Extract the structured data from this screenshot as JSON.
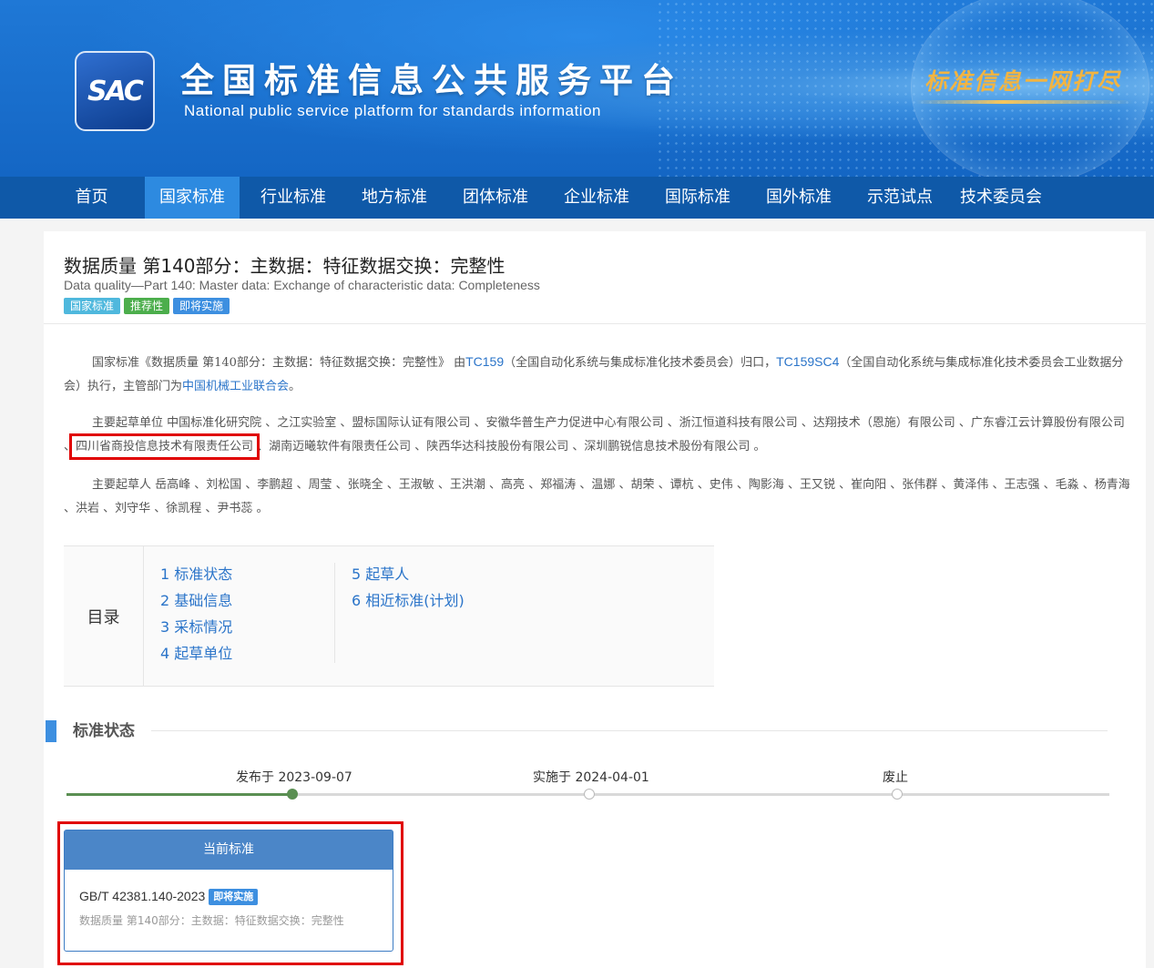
{
  "header": {
    "logo_text": "SAC",
    "site_title": "全国标准信息公共服务平台",
    "site_subtitle": "National public service platform  for standards information",
    "slogan": "标准信息一网打尽"
  },
  "nav": {
    "items": [
      "首页",
      "国家标准",
      "行业标准",
      "地方标准",
      "团体标准",
      "企业标准",
      "国际标准",
      "国外标准",
      "示范试点",
      "技术委员会"
    ],
    "active": "国家标准"
  },
  "standard": {
    "title": "数据质量 第140部分：主数据：特征数据交换：完整性",
    "title_en": "Data quality—Part 140: Master data: Exchange of characteristic data: Completeness",
    "tags": [
      {
        "label": "国家标准",
        "color": "#4fb8dd"
      },
      {
        "label": "推荐性",
        "color": "#4cae4c"
      },
      {
        "label": "即将实施",
        "color": "#3d8fe0"
      }
    ]
  },
  "description": {
    "p1_a": "国家标准《数据质量 第140部分：主数据：特征数据交换：完整性》 由",
    "tc_link": "TC159",
    "p1_b": "（全国自动化系统与集成标准化技术委员会）归口，",
    "sc_link": "TC159SC4",
    "p1_c": "（全国自动化系统与集成标准化技术委员会工业数据分会）执行，主管部门为",
    "dept_link": "中国机械工业联合会",
    "p1_d": "。",
    "units_a": "主要起草单位 中国标准化研究院 、之江实验室 、盟标国际认证有限公司 、安徽华普生产力促进中心有限公司 、浙江恒道科技有限公司 、达翔技术（恩施）有限公司 、广东睿江云计算股份有限公司 、",
    "units_highlight": "四川省商投信息技术有限责任公司",
    "units_b": " 、湖南迈曦软件有限责任公司 、陕西华达科技股份有限公司 、深圳鹏锐信息技术股份有限公司 。",
    "drafters": "主要起草人 岳高峰 、刘松国 、李鹏超 、周莹 、张晓全 、王淑敏 、王洪潮 、高亮 、郑福涛 、温娜 、胡荣 、谭杭 、史伟 、陶影海 、王又锐 、崔向阳 、张伟群 、黄泽伟 、王志强 、毛淼 、杨青海 、洪岩 、刘守华 、徐凯程 、尹书蕊 。"
  },
  "toc": {
    "label": "目录",
    "items": [
      "1  标准状态",
      "2  基础信息",
      "3  采标情况",
      "4  起草单位",
      "5  起草人",
      "6  相近标准(计划)"
    ]
  },
  "status": {
    "section_title": "标准状态",
    "timeline": [
      "发布于 2023-09-07",
      "实施于 2024-04-01",
      "废止"
    ],
    "current_header": "当前标准",
    "current_code": "GB/T 42381.140-2023",
    "current_badge": "即将实施",
    "current_name": "数据质量 第140部分：主数据：特征数据交换：完整性"
  }
}
